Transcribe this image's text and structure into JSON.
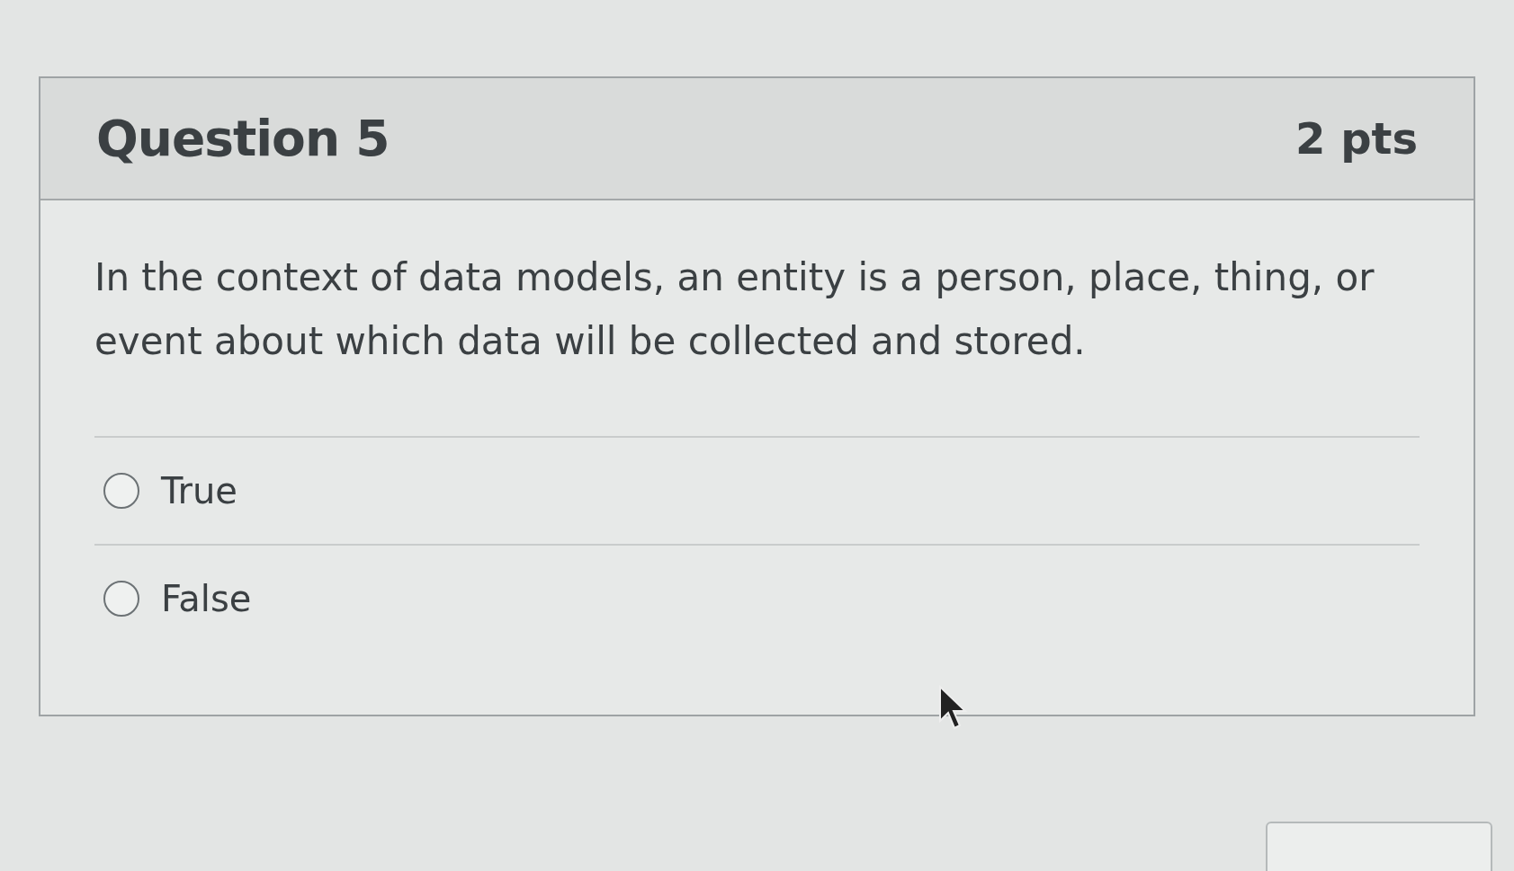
{
  "question": {
    "title": "Question 5",
    "points": "2 pts",
    "text": "In the context of data models, an entity is a person, place, thing, or event about which data will be collected and stored."
  },
  "answers": [
    {
      "label": "True",
      "selected": false
    },
    {
      "label": "False",
      "selected": false
    }
  ]
}
